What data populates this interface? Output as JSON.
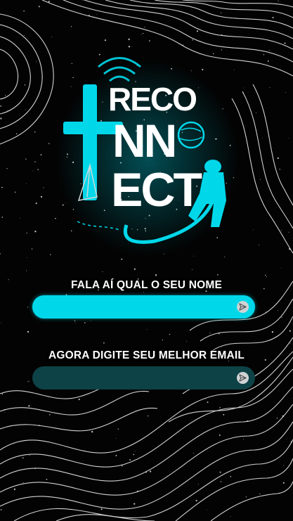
{
  "app": {
    "brand_lines": [
      "RECO",
      "NN",
      "ECT"
    ]
  },
  "name_prompt": {
    "label": "FALA AÍ QUAL O SEU NOME",
    "value": "",
    "placeholder": ""
  },
  "email_prompt": {
    "label": "AGORA DIGITE SEU MELHOR EMAIL",
    "value": "",
    "placeholder": ""
  },
  "icons": {
    "send": "send-icon"
  },
  "colors": {
    "accent": "#00d8ea",
    "field_dark": "#0d4247",
    "background": "#030303",
    "text": "#ffffff"
  }
}
